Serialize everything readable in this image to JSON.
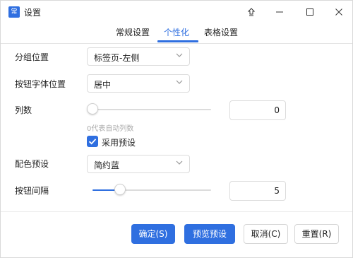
{
  "window": {
    "title": "设置",
    "app_icon_text": "常",
    "accent_color": "#2f6fe0"
  },
  "tabs": [
    {
      "label": "常规设置",
      "active": false
    },
    {
      "label": "个性化",
      "active": true
    },
    {
      "label": "表格设置",
      "active": false
    }
  ],
  "form": {
    "group_position": {
      "label": "分组位置",
      "value": "标签页-左侧"
    },
    "button_font_position": {
      "label": "按钮字体位置",
      "value": "居中"
    },
    "columns": {
      "label": "列数",
      "value": "0",
      "slider_fraction": 0,
      "hint": "0代表自动列数"
    },
    "use_preset": {
      "label": "采用预设",
      "checked": true
    },
    "color_preset": {
      "label": "配色预设",
      "value": "简约蓝"
    },
    "button_spacing": {
      "label": "按钮间隔",
      "value": "5",
      "slider_fraction": 0.23
    }
  },
  "footer": {
    "ok": "确定(S)",
    "preview": "预览预设",
    "cancel": "取消(C)",
    "reset": "重置(R)"
  },
  "icons": {
    "pin": "pin-icon",
    "minimize": "minimize-icon",
    "maximize": "maximize-icon",
    "close": "close-icon",
    "chevron": "chevron-down-icon",
    "check": "check-icon"
  }
}
